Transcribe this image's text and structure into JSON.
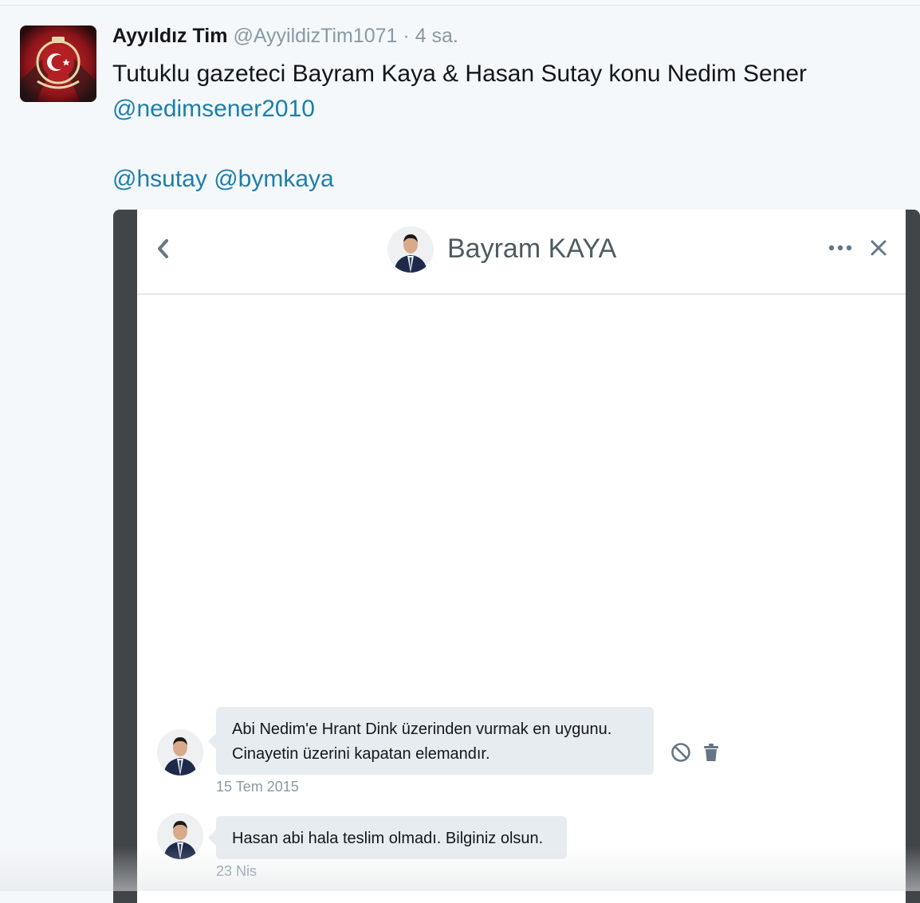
{
  "tweet": {
    "author_name": "Ayyıldız Tim",
    "author_handle": "@AyyildizTim1071",
    "separator": "·",
    "time": "4 sa.",
    "text_line1": "Tutuklu gazeteci Bayram Kaya & Hasan Sutay konu Nedim Sener",
    "mention1": "@nedimsener2010",
    "mention2": "@hsutay",
    "mention3": "@bymkaya",
    "avatar_icon": "crescent-star-emblem-icon"
  },
  "dm": {
    "contact_name": "Bayram KAYA",
    "icons": {
      "back": "chevron-left-icon",
      "more": "more-dots-icon",
      "close": "close-icon",
      "report": "block-icon",
      "delete": "trash-icon"
    },
    "messages": [
      {
        "line1": "Abi Nedim'e Hrant Dink üzerinden vurmak en uygunu.",
        "line2": "Cinayetin üzerini kapatan elemandır.",
        "time": "15 Tem 2015"
      },
      {
        "line1": "Hasan abi hala teslim olmadı. Bilginiz olsun.",
        "time": "23 Nis"
      }
    ]
  },
  "colors": {
    "link": "#1b7fac",
    "muted": "#8899a6",
    "bubble": "#e6ecf0",
    "media_frame": "#424548"
  }
}
